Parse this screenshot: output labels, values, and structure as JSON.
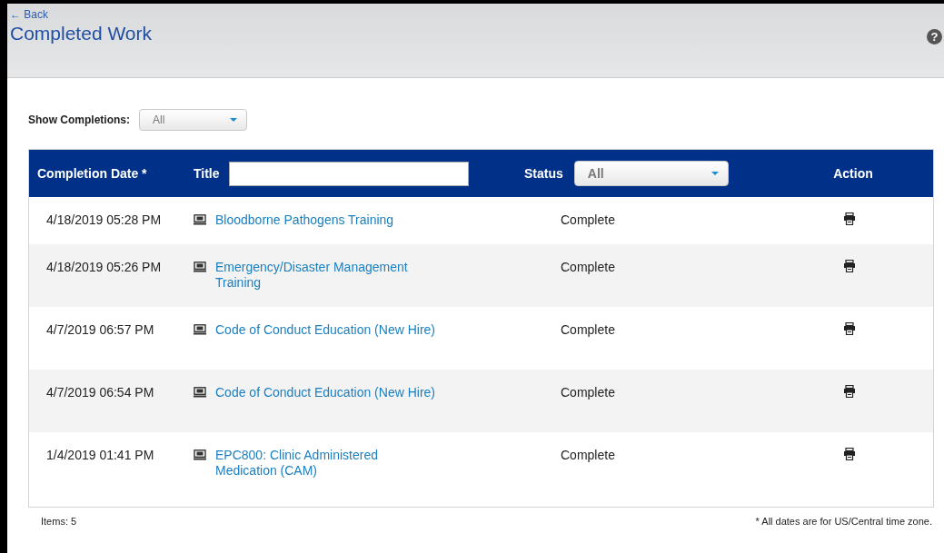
{
  "header": {
    "back_link": "← Back",
    "title": "Completed Work",
    "help": "?"
  },
  "filter": {
    "label": "Show Completions:",
    "value": "All"
  },
  "table": {
    "columns": [
      {
        "label": "Completion Date *",
        "kind": "text"
      },
      {
        "label": "Title",
        "kind": "search"
      },
      {
        "label": "Status",
        "kind": "select",
        "value": "All"
      },
      {
        "label": "Action",
        "kind": "text"
      }
    ],
    "rows": [
      {
        "date": "4/18/2019 05:28 PM",
        "title": "Bloodborne Pathogens Training",
        "status": "Complete"
      },
      {
        "date": "4/18/2019 05:26 PM",
        "title": "Emergency/Disaster Management Training",
        "status": "Complete"
      },
      {
        "date": "4/7/2019 06:57 PM",
        "title": "Code of Conduct Education (New Hire)",
        "status": "Complete"
      },
      {
        "date": "4/7/2019 06:54 PM",
        "title": "Code of Conduct Education (New Hire)",
        "status": "Complete"
      },
      {
        "date": "1/4/2019 01:41 PM",
        "title": "EPC800: Clinic Administered Medication (CAM)",
        "status": "Complete"
      }
    ]
  },
  "footer": {
    "count": "Items: 5",
    "note": "* All dates are for US/Central time zone."
  }
}
